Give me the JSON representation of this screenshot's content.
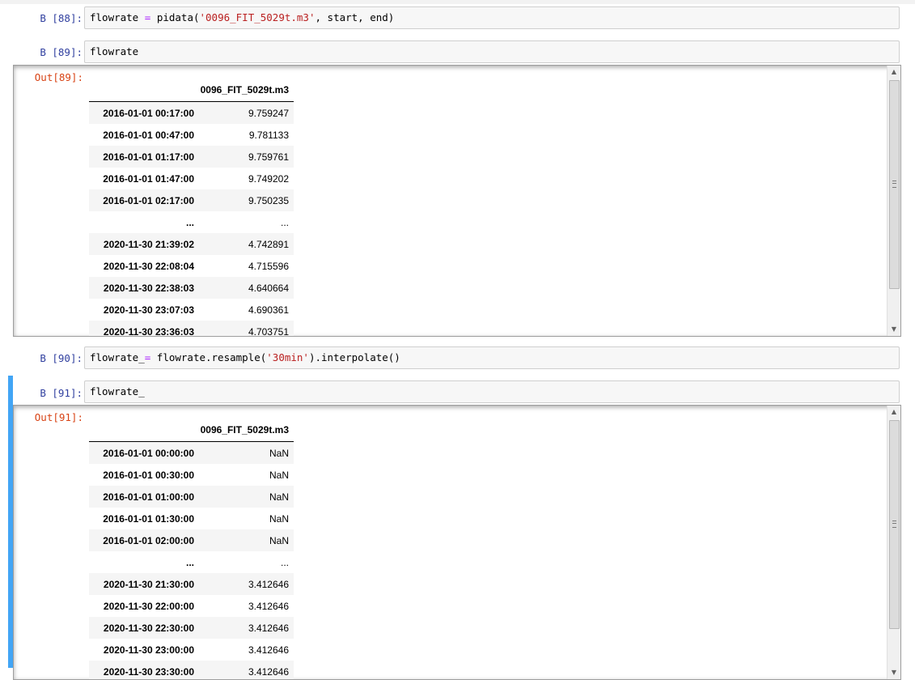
{
  "cells": [
    {
      "prompt": "В [88]:",
      "code": {
        "var": "flowrate",
        "op": "=",
        "func": "pidata(",
        "arg": "'0096_FIT_5029t.m3'",
        "rest": ", start, end)"
      }
    },
    {
      "prompt": "В [89]:",
      "code": "flowrate",
      "output": {
        "prompt": "Out[89]:",
        "column": "0096_FIT_5029t.m3",
        "rows": [
          {
            "idx": "2016-01-01 00:17:00",
            "val": "9.759247"
          },
          {
            "idx": "2016-01-01 00:47:00",
            "val": "9.781133"
          },
          {
            "idx": "2016-01-01 01:17:00",
            "val": "9.759761"
          },
          {
            "idx": "2016-01-01 01:47:00",
            "val": "9.749202"
          },
          {
            "idx": "2016-01-01 02:17:00",
            "val": "9.750235"
          },
          {
            "idx": "...",
            "val": "..."
          },
          {
            "idx": "2020-11-30 21:39:02",
            "val": "4.742891"
          },
          {
            "idx": "2020-11-30 22:08:04",
            "val": "4.715596"
          },
          {
            "idx": "2020-11-30 22:38:03",
            "val": "4.640664"
          },
          {
            "idx": "2020-11-30 23:07:03",
            "val": "4.690361"
          },
          {
            "idx": "2020-11-30 23:36:03",
            "val": "4.703751"
          }
        ]
      }
    },
    {
      "prompt": "В [90]:",
      "code": {
        "var": "flowrate_",
        "op": "=",
        "func": " flowrate.resample(",
        "arg": "'30min'",
        "rest": ").interpolate()"
      }
    },
    {
      "prompt": "В [91]:",
      "code": "flowrate_",
      "output": {
        "prompt": "Out[91]:",
        "column": "0096_FIT_5029t.m3",
        "rows": [
          {
            "idx": "2016-01-01 00:00:00",
            "val": "NaN"
          },
          {
            "idx": "2016-01-01 00:30:00",
            "val": "NaN"
          },
          {
            "idx": "2016-01-01 01:00:00",
            "val": "NaN"
          },
          {
            "idx": "2016-01-01 01:30:00",
            "val": "NaN"
          },
          {
            "idx": "2016-01-01 02:00:00",
            "val": "NaN"
          },
          {
            "idx": "...",
            "val": "..."
          },
          {
            "idx": "2020-11-30 21:30:00",
            "val": "3.412646"
          },
          {
            "idx": "2020-11-30 22:00:00",
            "val": "3.412646"
          },
          {
            "idx": "2020-11-30 22:30:00",
            "val": "3.412646"
          },
          {
            "idx": "2020-11-30 23:00:00",
            "val": "3.412646"
          },
          {
            "idx": "2020-11-30 23:30:00",
            "val": "3.412646"
          }
        ]
      }
    }
  ],
  "icons": {
    "scroll_up": "▲",
    "scroll_down": "▼"
  },
  "colors": {
    "selected_cell_bar": "#42a5f5",
    "in_prompt": "#303f9f",
    "out_prompt": "#d84315",
    "string_literal": "#ba2121",
    "operator": "#aa22ff"
  }
}
